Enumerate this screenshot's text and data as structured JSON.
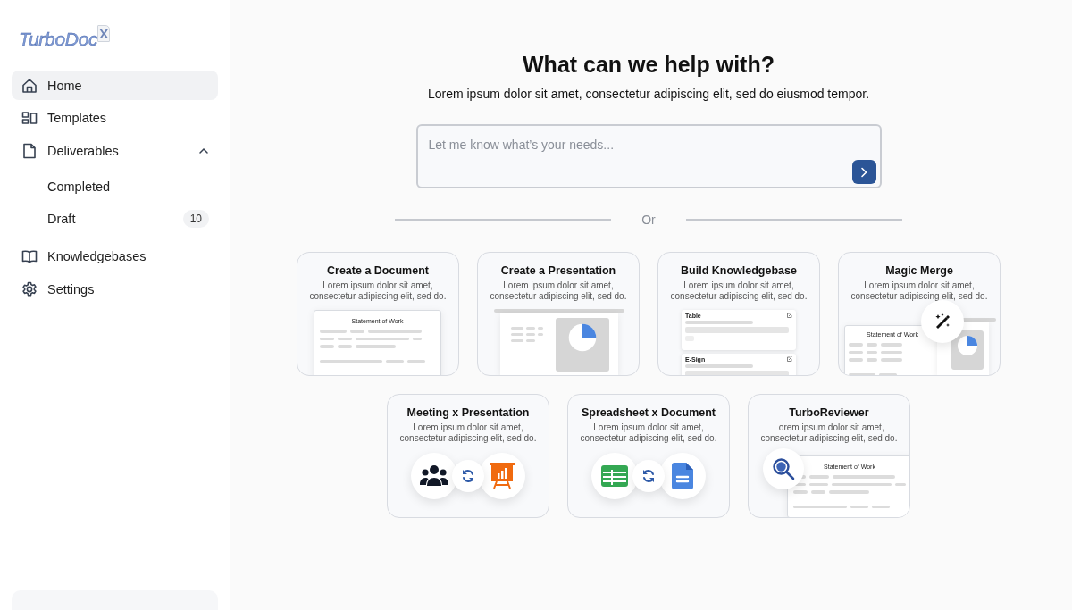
{
  "logo": {
    "name": "TurboDoc",
    "badge": "X"
  },
  "sidebar": {
    "items": [
      {
        "kind": "home",
        "label": "Home",
        "selected": true
      },
      {
        "kind": "templates",
        "label": "Templates",
        "selected": false
      },
      {
        "kind": "file",
        "label": "Deliverables",
        "selected": false,
        "expanded": true,
        "children": [
          {
            "label": "Completed",
            "selected": false
          },
          {
            "label": "Draft",
            "selected": false,
            "badge": "10"
          }
        ]
      },
      {
        "kind": "book",
        "label": "Knowledgebases",
        "selected": false
      },
      {
        "kind": "gear",
        "label": "Settings",
        "selected": false
      }
    ]
  },
  "main": {
    "heading": "What can we help with?",
    "subheading": "Lorem ipsum dolor sit amet, consectetur adipiscing elit, sed do eiusmod tempor.",
    "prompt": {
      "placeholder": "Let me know what’s your needs..."
    },
    "divider": "Or",
    "cards": [
      {
        "title": "Create a Document",
        "description": "Lorem ipsum dolor sit amet, consectetur adipiscing elit, sed do.",
        "art": {
          "kind": "document",
          "texts": [
            "Statement of Work"
          ]
        }
      },
      {
        "title": "Create a Presentation",
        "description": "Lorem ipsum dolor sit amet, consectetur adipiscing elit, sed do.",
        "art": {
          "kind": "presentation"
        }
      },
      {
        "title": "Build Knowledgebase",
        "description": "Lorem ipsum dolor sit amet, consectetur adipiscing elit, sed do.",
        "art": {
          "kind": "knowledge",
          "texts": [
            "Table",
            "E-Sign"
          ]
        }
      },
      {
        "title": "Magic Merge",
        "description": "Lorem ipsum dolor sit amet, consectetur adipiscing elit, sed do.",
        "art": {
          "kind": "merge",
          "texts": [
            "Statement of Work"
          ]
        }
      },
      {
        "title": "Meeting x Presentation",
        "description": "Lorem ipsum dolor sit amet, consectetur adipiscing elit, sed do.",
        "art": {
          "kind": "meeting"
        }
      },
      {
        "title": "Spreadsheet x Document",
        "description": "Lorem ipsum dolor sit amet, consectetur adipiscing elit, sed do.",
        "art": {
          "kind": "spreadsheet"
        }
      },
      {
        "title": "TurboReviewer",
        "description": "Lorem ipsum dolor sit amet, consectetur adipiscing elit, sed do.",
        "art": {
          "kind": "reviewer",
          "texts": [
            "Statement of Work"
          ]
        }
      }
    ]
  }
}
